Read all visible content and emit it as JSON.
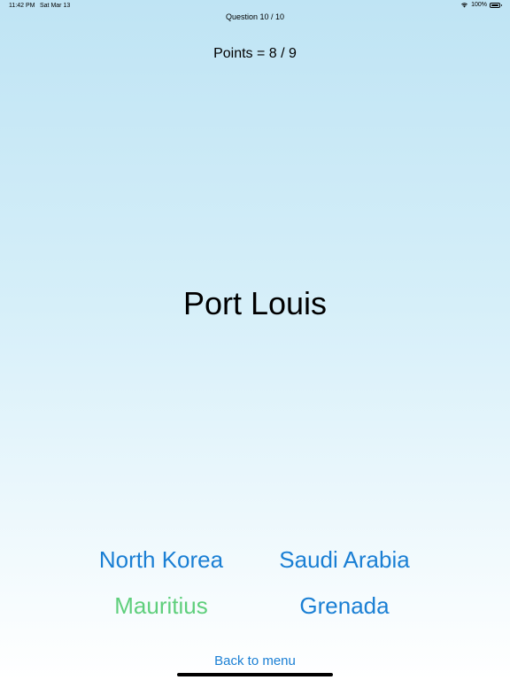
{
  "status_bar": {
    "time": "11:42 PM",
    "date": "Sat Mar 13",
    "battery": "100%",
    "icons": [
      "wifi-icon",
      "battery-icon"
    ]
  },
  "quiz": {
    "question_counter": "Question 10 / 10",
    "points": "Points = 8 / 9",
    "capital": "Port Louis",
    "answers": [
      {
        "label": "North Korea",
        "state": "default"
      },
      {
        "label": "Saudi Arabia",
        "state": "default"
      },
      {
        "label": "Mauritius",
        "state": "correct"
      },
      {
        "label": "Grenada",
        "state": "default"
      }
    ],
    "back_label": "Back to menu"
  },
  "colors": {
    "accent": "#1a7fd4",
    "correct": "#5fcf7c",
    "background_top": "#bfe4f4",
    "background_bottom": "#ffffff"
  }
}
